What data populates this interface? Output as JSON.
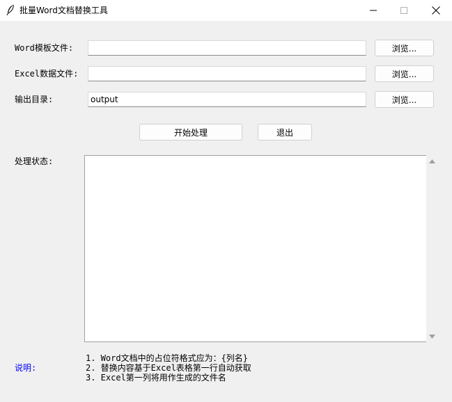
{
  "window": {
    "title": "批量Word文档替换工具"
  },
  "form": {
    "word_template_label": "Word模板文件:",
    "word_template_value": "",
    "excel_data_label": "Excel数据文件:",
    "excel_data_value": "",
    "output_dir_label": "输出目录:",
    "output_dir_value": "output",
    "browse_label": "浏览..."
  },
  "actions": {
    "start_label": "开始处理",
    "exit_label": "退出"
  },
  "status": {
    "label": "处理状态:",
    "text": ""
  },
  "notes": {
    "label": "说明:",
    "lines": [
      "1. Word文档中的占位符格式应为：{列名}",
      "2. 替换内容基于Excel表格第一行自动获取",
      "3. Excel第一列将用作生成的文件名"
    ]
  },
  "colors": {
    "window_bg": "#f0f0f0",
    "note_label": "#0000ff"
  },
  "icons": {
    "app": "feather-icon",
    "minimize": "minimize-icon",
    "maximize": "maximize-icon",
    "close": "close-icon",
    "scroll_up": "arrow-up-icon",
    "scroll_down": "arrow-down-icon"
  }
}
